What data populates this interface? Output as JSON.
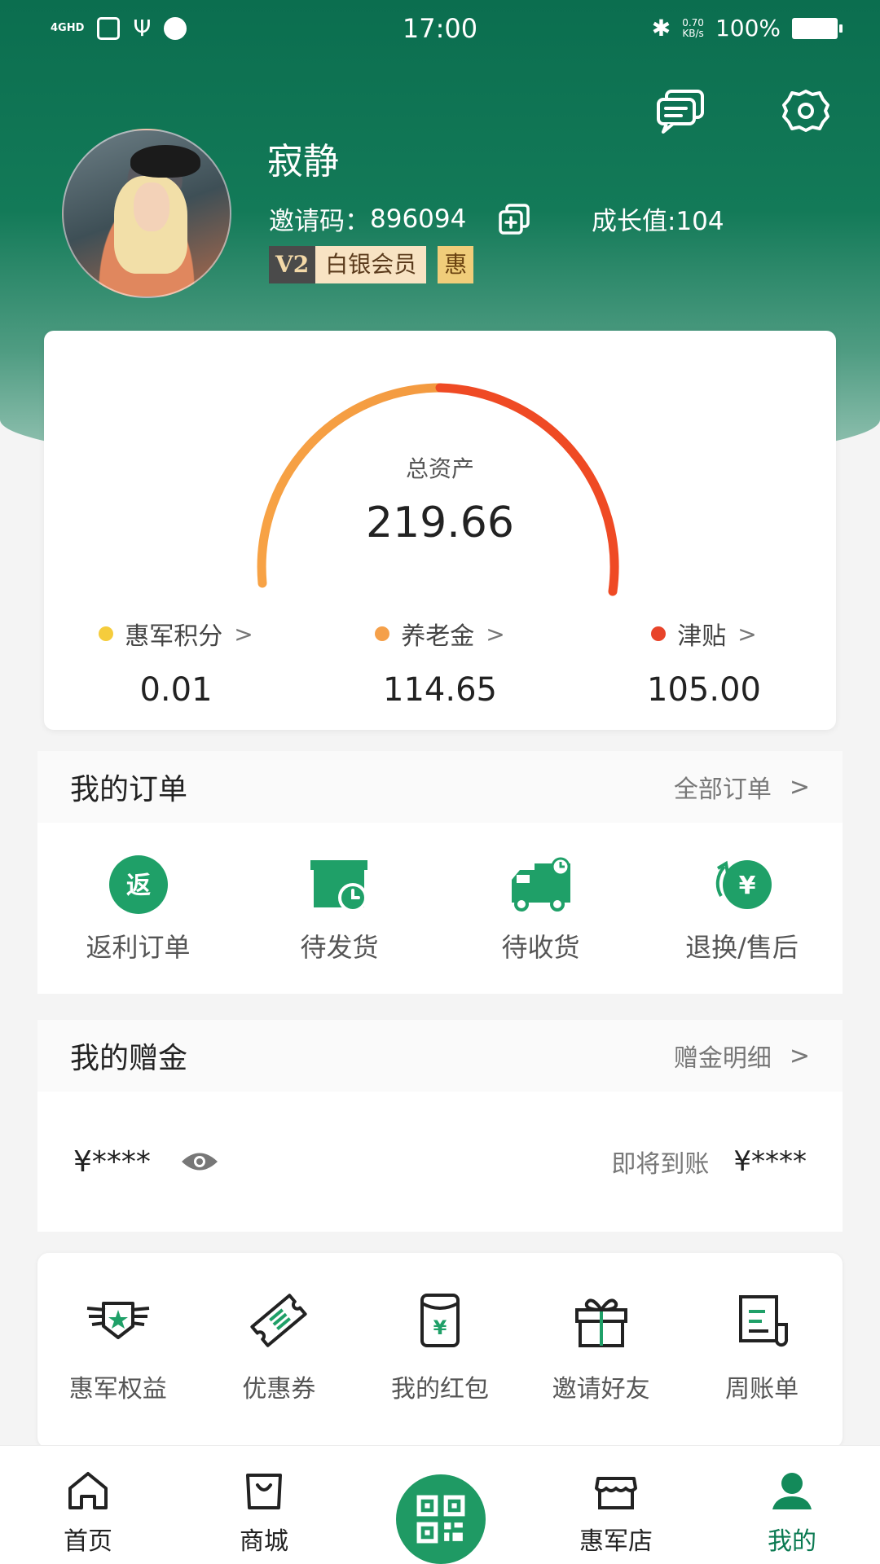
{
  "status_bar": {
    "network": "4GHD",
    "time": "17:00",
    "speed_value": "0.70",
    "speed_unit": "KB/s",
    "battery": "100%"
  },
  "profile": {
    "name": "寂静",
    "invite_label": "邀请码：",
    "invite_code": "896094",
    "growth": "成长值:104",
    "vip_level": "V2",
    "vip_name": "白银会员",
    "hui_badge": "惠"
  },
  "assets": {
    "label": "总资产",
    "total": "219.66",
    "items": [
      {
        "label": "惠军积分",
        "value": "0.01",
        "color": "#f5cc3c"
      },
      {
        "label": "养老金",
        "value": "114.65",
        "color": "#f5a04a"
      },
      {
        "label": "津贴",
        "value": "105.00",
        "color": "#e8442a"
      }
    ],
    "gauge_colors": [
      "#f5a04a",
      "#ef4a24"
    ],
    "chevron": ">"
  },
  "orders": {
    "title": "我的订单",
    "more": "全部订单",
    "chevron": ">",
    "items": [
      {
        "label": "返利订单",
        "icon": "rebate-icon",
        "glyph": "返"
      },
      {
        "label": "待发货",
        "icon": "pending-ship-icon"
      },
      {
        "label": "待收货",
        "icon": "delivery-truck-icon"
      },
      {
        "label": "退换/售后",
        "icon": "refund-icon",
        "glyph": "¥"
      }
    ]
  },
  "gift": {
    "title": "我的赠金",
    "more": "赠金明细",
    "chevron": ">",
    "amount": "¥****",
    "pending_label": "即将到账",
    "pending_value": "¥****"
  },
  "tools": [
    {
      "label": "惠军权益",
      "icon": "badge-wings-icon"
    },
    {
      "label": "优惠券",
      "icon": "coupon-icon"
    },
    {
      "label": "我的红包",
      "icon": "red-packet-icon",
      "glyph": "¥"
    },
    {
      "label": "邀请好友",
      "icon": "gift-icon"
    },
    {
      "label": "周账单",
      "icon": "bill-icon"
    }
  ],
  "nav": [
    {
      "label": "首页",
      "icon": "home-icon"
    },
    {
      "label": "商城",
      "icon": "shopping-bag-icon"
    },
    {
      "label": "惠军店",
      "icon": "store-icon"
    },
    {
      "label": "我的",
      "icon": "user-icon",
      "active": true
    }
  ],
  "brand_green": "#1a9a62"
}
